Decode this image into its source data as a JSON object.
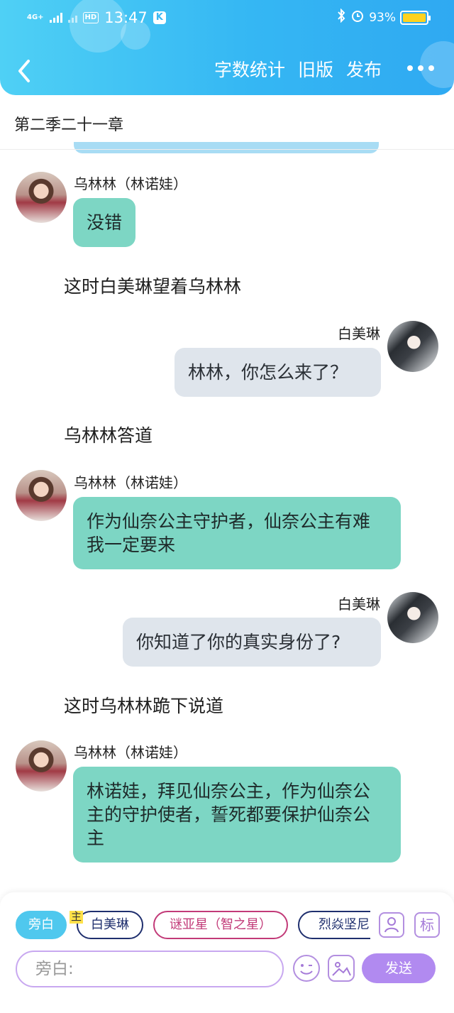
{
  "status_bar": {
    "network": "4G+",
    "hd": "HD",
    "time": "13:47",
    "app_badge": "K",
    "battery": "93%"
  },
  "nav": {
    "items": [
      "字数统计",
      "旧版",
      "发布"
    ]
  },
  "chapter_title": "第二季二十一章",
  "messages": [
    {
      "speaker": "乌林林（林诺娃）",
      "text": "没错"
    },
    {
      "narration": "这时白美琳望着乌林林"
    },
    {
      "speaker": "白美琳",
      "text": "林林，你怎么来了？"
    },
    {
      "narration": "乌林林答道"
    },
    {
      "speaker": "乌林林（林诺娃）",
      "text": "作为仙奈公主守护者，仙奈公主有难我一定要来"
    },
    {
      "speaker": "白美琳",
      "text": "你知道了你的真实身份了?"
    },
    {
      "narration": "这时乌林林跪下说道"
    },
    {
      "speaker": "乌林林（林诺娃）",
      "text": "林诺娃，拜见仙奈公主，作为仙奈公主的守护使者，誓死都要保护仙奈公主"
    }
  ],
  "roles": [
    "旁白",
    "白美琳",
    "谜亚星（智之星）",
    "烈焱坚尼"
  ],
  "main_tag": "主",
  "tools": {
    "biao": "标"
  },
  "input": {
    "placeholder": "旁白:"
  },
  "send_label": "发送",
  "colors": {
    "header": "#35b7f3",
    "left_bubble": "#7dd6c4",
    "right_bubble": "#dfe5ec",
    "send": "#b18af0"
  }
}
